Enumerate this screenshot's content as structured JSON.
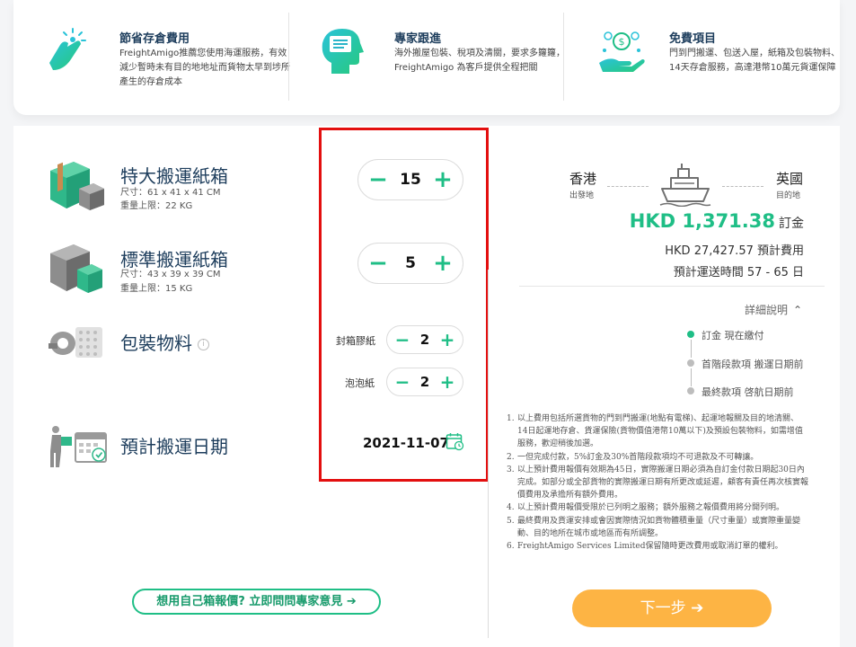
{
  "features": [
    {
      "icon": "tap-hand-icon",
      "title": "節省存倉費用",
      "desc": "FreightAmigo推薦您使用海運服務，有效減少暫時未有目的地地址而貨物太早到埗所產生的存倉成本"
    },
    {
      "icon": "expert-chat-icon",
      "title": "專家跟進",
      "desc": "海外搬屋包裝、稅項及清關，要求多籮籮，FreightAmigo 為客戶提供全程把關"
    },
    {
      "icon": "free-items-icon",
      "title": "免費項目",
      "desc": "門到門搬運、包送入屋，紙箱及包裝物料、14天存倉服務，高達港幣10萬元貨運保障"
    }
  ],
  "items": {
    "xl_box": {
      "name": "特大搬運紙箱",
      "size": "尺寸：61 x 41 x 41 CM",
      "weight": "重量上限：22 KG",
      "qty": "15"
    },
    "std_box": {
      "name": "標準搬運紙箱",
      "size": "尺寸：43 x 39 x 39 CM",
      "weight": "重量上限：15 KG",
      "qty": "5"
    },
    "packing": {
      "name": "包裝物料",
      "info": "i",
      "tape": {
        "label": "封箱膠紙",
        "qty": "2"
      },
      "bubble": {
        "label": "泡泡紙",
        "qty": "2"
      }
    },
    "date": {
      "name": "預計搬運日期",
      "value": "2021-11-07"
    }
  },
  "controls": {
    "minus": "−",
    "plus": "+"
  },
  "expert_button": "想用自己箱報價? 立即問問專家意見 ➔",
  "route": {
    "from": "香港",
    "from_sub": "出發地",
    "to": "英國",
    "to_sub": "目的地"
  },
  "price": {
    "deposit_amount": "HKD 1,371.38",
    "deposit_label": "訂金",
    "estimated": "HKD 27,427.57 預計費用",
    "delivery_time": "預計運送時間 57 - 65 日"
  },
  "details": {
    "toggle": "詳細說明",
    "timeline": [
      {
        "text": "訂金 現在繳付",
        "active": true
      },
      {
        "text": "首階段款項 搬運日期前",
        "active": false
      },
      {
        "text": "最終款項 啓航日期前",
        "active": false
      }
    ]
  },
  "notes": [
    {
      "n": "1.",
      "text": "以上費用包括所選貨物的門到門搬運(地點有電梯)、起運地報關及目的地清關、14日起運地存倉、貨運保險(貨物價值港幣10萬以下)及預設包裝物料，如需增值服務，歡迎稍後加選。"
    },
    {
      "n": "2.",
      "text": "一但完成付款，5%訂金及30%首階段款項均不可退款及不可轉讓。"
    },
    {
      "n": "3.",
      "text": "以上預計費用報價有效期為45日，實際搬運日期必須為自訂金付款日期起30日內完成。如部分或全部貨物的實際搬運日期有所更改或延遲，顧客有責任再次核實報價費用及承擔所有額外費用。"
    },
    {
      "n": "4.",
      "text": "以上預計費用報價受限於已列明之服務；額外服務之報價費用將分開列明。"
    },
    {
      "n": "5.",
      "text": "最終費用及貨運安排或會因實際情況如貨物體積重量（尺寸重量）或實際重量變動、目的地所在城市或地區而有所調整。"
    },
    {
      "n": "6.",
      "text": "FreightAmigo Services Limited保留隨時更改費用或取消訂單的權利。"
    }
  ],
  "next_button": "下一步 ➔",
  "colors": {
    "accent": "#1fbe86",
    "cta": "#fdb444",
    "highlight": "#e30f0f",
    "title": "#1d3d5c"
  }
}
